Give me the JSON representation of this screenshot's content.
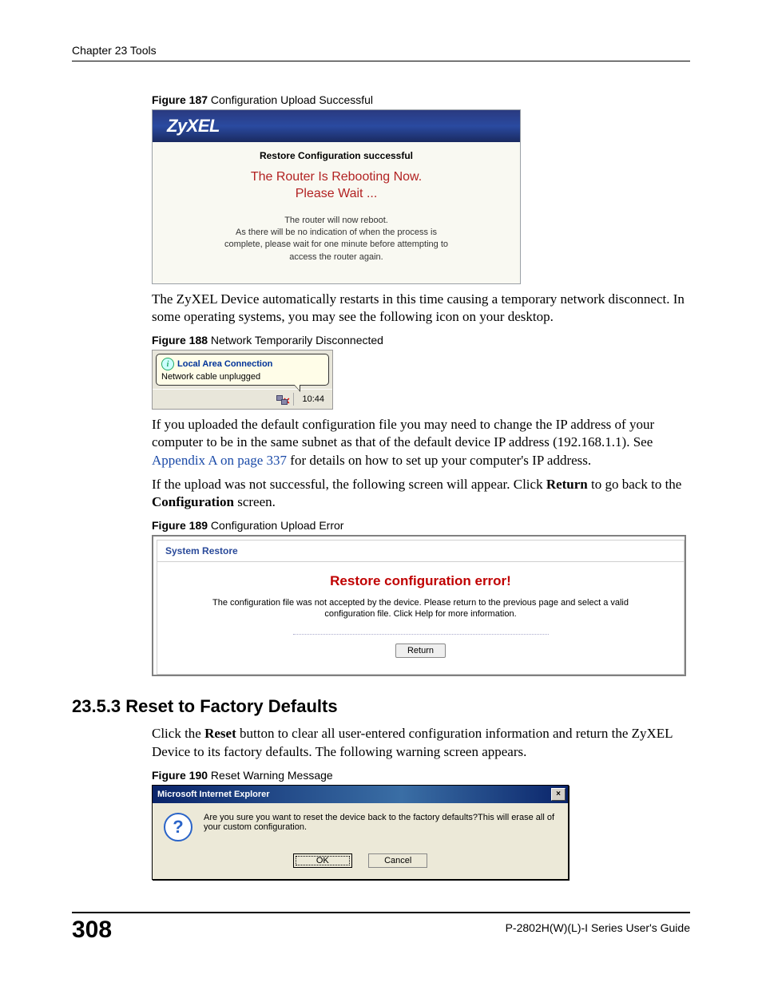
{
  "header": {
    "chapter_line": "Chapter 23 Tools"
  },
  "fig187": {
    "caption_num": "Figure 187",
    "caption_text": "   Configuration Upload Successful",
    "brand": "ZyXEL",
    "title": "Restore Configuration successful",
    "reboot_l1": "The Router Is Rebooting Now.",
    "reboot_l2": "Please Wait ...",
    "note_l1": "The router will now reboot.",
    "note_l2": "As there will be no indication of when the process is",
    "note_l3": "complete, please wait for one minute before attempting to",
    "note_l4": "access the router again."
  },
  "para1": "The ZyXEL Device automatically restarts in this time causing a temporary network disconnect. In some operating systems, you may see the following icon on your desktop.",
  "fig188": {
    "caption_num": "Figure 188",
    "caption_text": "   Network Temporarily Disconnected",
    "balloon_title": "Local Area Connection",
    "balloon_msg": "Network cable unplugged",
    "clock": "10:44"
  },
  "para2a": "If you uploaded the default configuration file you may need to change the IP address of your computer to be in the same subnet as that of the default device IP address (192.168.1.1). See ",
  "para2link": "Appendix A on page 337",
  "para2b": " for details on how to set up your computer's IP address.",
  "para3a": "If the upload was not successful, the following screen will appear. Click ",
  "para3b": "Return",
  "para3c": " to go back to the ",
  "para3d": "Configuration",
  "para3e": " screen.",
  "fig189": {
    "caption_num": "Figure 189",
    "caption_text": "   Configuration Upload Error",
    "panel_title": "System Restore",
    "error_headline": "Restore configuration error!",
    "error_msg": "The configuration file was not accepted by the device. Please return to the previous page and select a valid configuration file. Click Help for more information.",
    "return_btn": "Return"
  },
  "section": {
    "num": "23.5.3",
    "title": "  Reset to Factory Defaults"
  },
  "para4a": "Click the ",
  "para4b": "Reset",
  "para4c": " button to clear all user-entered configuration information and return the ZyXEL Device to its factory defaults. The following warning screen appears.",
  "fig190": {
    "caption_num": "Figure 190",
    "caption_text": "   Reset Warning Message",
    "titlebar": "Microsoft Internet Explorer",
    "close_x": "×",
    "q": "?",
    "msg": "Are you sure you want to reset the device back to the factory defaults?This will erase all of your custom configuration.",
    "ok": "OK",
    "cancel": "Cancel"
  },
  "footer": {
    "page": "308",
    "guide": "P-2802H(W)(L)-I Series User's Guide"
  }
}
